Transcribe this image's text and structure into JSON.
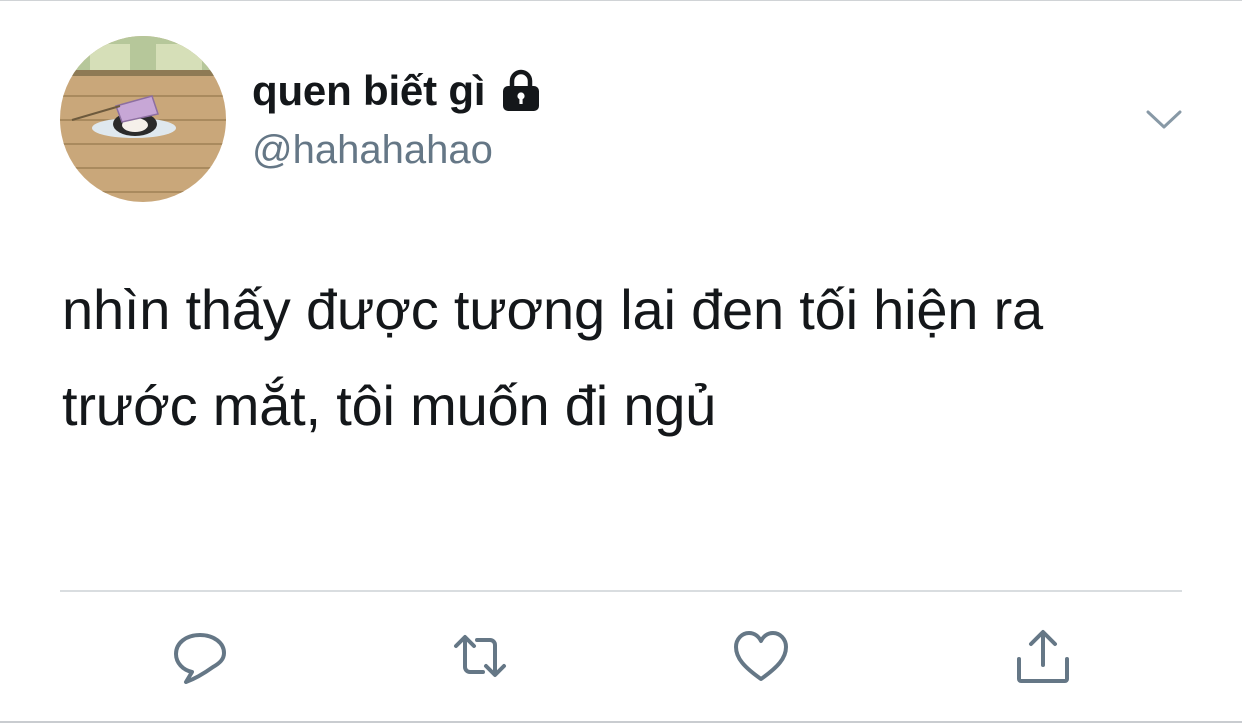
{
  "user": {
    "display_name": "quen biết gì",
    "handle": "@hahahahao",
    "protected": true
  },
  "tweet": {
    "text_line1": "nhìn thấy được tương lai đen tối hiện ra",
    "text_line2": "trước mắt, tôi muốn đi ngủ"
  },
  "icons": {
    "lock": "lock-icon",
    "menu": "chevron-down-icon",
    "reply": "speech-bubble-icon",
    "retweet": "retweet-arrows-icon",
    "like": "heart-icon",
    "share": "share-upload-icon"
  },
  "colors": {
    "text_primary": "#14171a",
    "text_secondary": "#657786",
    "icon_gray": "#657786",
    "divider": "#d9dde0"
  }
}
